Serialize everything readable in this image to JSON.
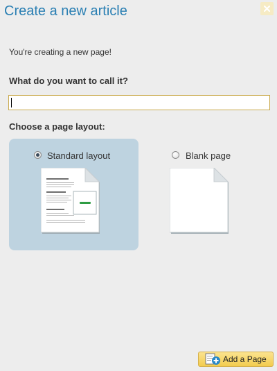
{
  "dialog": {
    "title": "Create a new article",
    "close_label": "X"
  },
  "intro": "You're creating a new page!",
  "name_field": {
    "label": "What do you want to call it?",
    "value": "",
    "placeholder": ""
  },
  "layout": {
    "label": "Choose a page layout:",
    "options": [
      {
        "label": "Standard layout",
        "selected": true,
        "icon": "standard-page-icon"
      },
      {
        "label": "Blank page",
        "selected": false,
        "icon": "blank-page-icon"
      }
    ]
  },
  "footer": {
    "add_button_label": "Add a Page",
    "add_button_icon": "add-page-icon"
  },
  "colors": {
    "title": "#2a7fb3",
    "selected_option_bg": "#bed3e0",
    "button_bg": "#f3cc4e",
    "close_bg": "#f6ebc4"
  }
}
